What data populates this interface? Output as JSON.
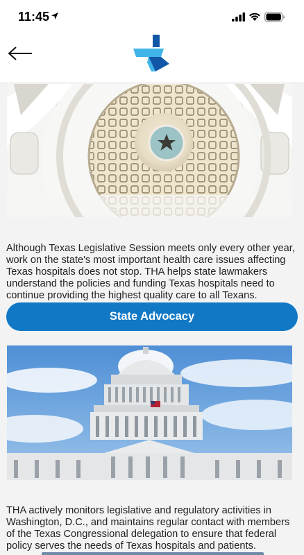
{
  "status_bar": {
    "time": "11:45",
    "icons": [
      "location-arrow-icon",
      "cellular-signal-icon",
      "wifi-icon",
      "battery-icon"
    ]
  },
  "nav": {
    "back_icon": "arrow-left-icon",
    "logo": "tha-logo"
  },
  "sections": [
    {
      "image": "texas-capitol-rotunda",
      "text": "Although Texas Legislative Session meets only every other year, work on the state's most important health care issues affecting Texas hospitals does not stop. THA helps state lawmakers understand the policies and funding Texas hospitals need to continue providing the highest quality care to all Texans.",
      "button_label": "State Advocacy"
    },
    {
      "image": "us-capitol-dome",
      "text": "THA actively monitors legislative and regulatory activities in Washington, D.C., and maintains regular contact with members of the Texas Congressional delegation to ensure that federal policy serves the needs of Texas hospitals and patients."
    }
  ],
  "colors": {
    "button": "#1178c6",
    "logo_light": "#3fb4e8",
    "logo_dark": "#1157a8",
    "background": "#f3f3f3"
  }
}
